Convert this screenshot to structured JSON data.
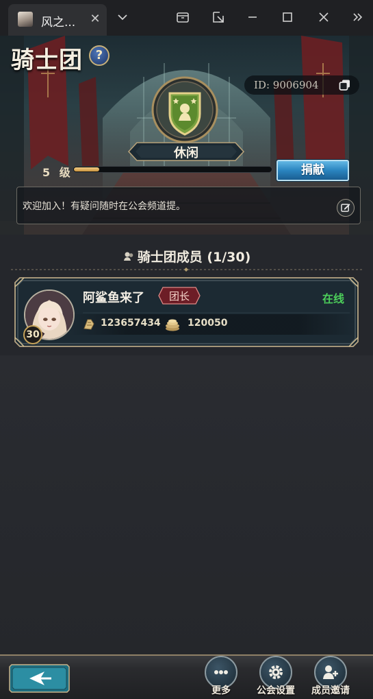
{
  "browser": {
    "tab_title": "风之...",
    "tab_close": "✕"
  },
  "guild": {
    "title": "骑士团",
    "help_symbol": "?",
    "id_text": "ID: 9006904",
    "rank": "休闲",
    "level_text": "5 级",
    "exp_progress": 0.13,
    "donate_label": "捐献",
    "announcement": "欢迎加入！有疑问随时在公会频道提。"
  },
  "members": {
    "title": "骑士团成员 (1/30)",
    "list": [
      {
        "name": "阿鲨鱼来了",
        "level": "30",
        "role": "团长",
        "status": "在线",
        "stat1": "123657434",
        "stat2": "120050"
      }
    ]
  },
  "bottom_nav": {
    "more": "更多",
    "settings": "公会设置",
    "invite": "成员邀请"
  },
  "colors": {
    "accent_gold": "#c6a35a",
    "online_green": "#4ccd5a",
    "donate_blue": "#2a84bf",
    "leader_red": "#8a2430"
  }
}
